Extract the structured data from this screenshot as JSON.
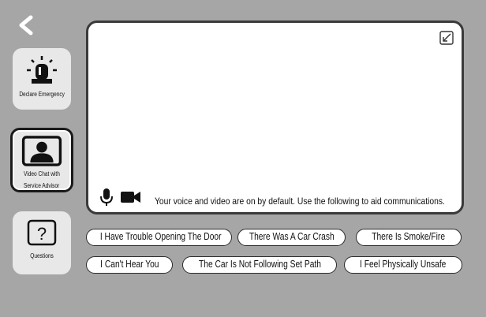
{
  "nav": {
    "back_icon": "chevron-left-icon"
  },
  "sidebar": {
    "items": [
      {
        "label": "Declare Emergency",
        "icon": "siren-icon"
      },
      {
        "label": "Video Chat with Service Advisor",
        "label_line1": "Video Chat with",
        "label_line2": "Service Advisor",
        "icon": "person-icon",
        "selected": true
      },
      {
        "label": "Questions",
        "icon": "question-icon"
      }
    ]
  },
  "video": {
    "hint": "Your voice and video are on by default.  Use the following to aid communications.",
    "mic_icon": "microphone-icon",
    "camera_icon": "video-camera-icon",
    "pip_icon": "minimize-window-icon"
  },
  "phrases": [
    "I Have Trouble Opening The Door",
    "There Was A Car Crash",
    "There Is Smoke/Fire",
    "I Can't Hear You",
    "The Car Is Not Following Set Path",
    "I Feel Physically Unsafe"
  ],
  "colors": {
    "background": "#a6a6a6",
    "panel": "#ffffff",
    "button": "#e8e8e8",
    "border": "#2a2a2a"
  }
}
